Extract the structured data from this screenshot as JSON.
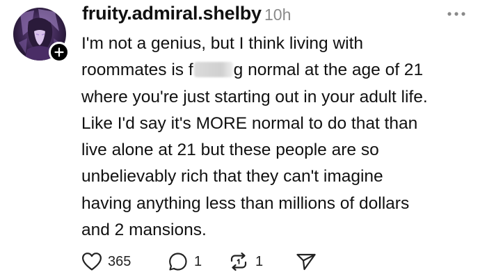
{
  "post": {
    "username": "fruity.admiral.shelby",
    "timestamp": "10h",
    "lines": [
      {
        "text": "I'm not a genius, but I think living with"
      },
      {
        "before": "roommates is f",
        "after": "g normal at the age of 21"
      },
      {
        "text": "where you're just starting out in your adult life."
      },
      {
        "text": "Like I'd say it's MORE normal to do that than"
      },
      {
        "text": "live alone at 21 but these people are so"
      },
      {
        "text": "unbelievably rich that they can't imagine"
      },
      {
        "text": "having anything less than millions of dollars"
      },
      {
        "text": "and 2 mansions."
      }
    ]
  },
  "actions": {
    "likes": "365",
    "replies": "1",
    "reposts": "1"
  },
  "icons": {
    "more": "more-horizontal-icon",
    "follow": "plus-icon",
    "like": "heart-icon",
    "reply": "comment-icon",
    "repost": "repost-icon",
    "share": "send-icon"
  },
  "colors": {
    "text": "#111111",
    "muted": "#8a8a8a",
    "badge": "#000000"
  }
}
